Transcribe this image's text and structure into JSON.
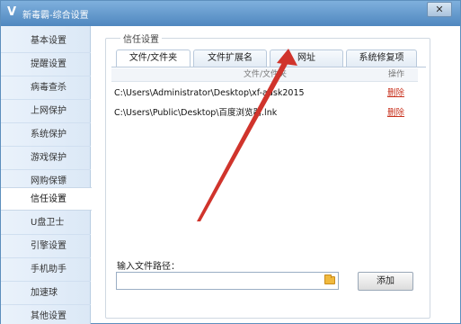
{
  "window": {
    "title": "新毒霸-综合设置",
    "logo": "V",
    "close": "✕"
  },
  "sidebar": {
    "items": [
      {
        "label": "基本设置"
      },
      {
        "label": "提醒设置"
      },
      {
        "label": "病毒查杀"
      },
      {
        "label": "上网保护"
      },
      {
        "label": "系统保护"
      },
      {
        "label": "游戏保护"
      },
      {
        "label": "网购保镖"
      },
      {
        "label": "信任设置",
        "active": true
      },
      {
        "label": "U盘卫士"
      },
      {
        "label": "引擎设置"
      },
      {
        "label": "手机助手"
      },
      {
        "label": "加速球"
      },
      {
        "label": "其他设置"
      }
    ]
  },
  "trust": {
    "group_title": "信任设置",
    "tabs": [
      {
        "label": "文件/文件夹",
        "active": true
      },
      {
        "label": "文件扩展名"
      },
      {
        "label": "网址"
      },
      {
        "label": "系统修复项"
      }
    ],
    "table": {
      "headers": {
        "path": "文件/文件夹",
        "action": "操作"
      },
      "rows": [
        {
          "path": "C:\\Users\\Administrator\\Desktop\\xf-adsk2015",
          "action": "删除"
        },
        {
          "path": "C:\\Users\\Public\\Desktop\\百度浏览器.lnk",
          "action": "删除"
        }
      ]
    },
    "input": {
      "label": "输入文件路径：",
      "value": "",
      "placeholder": ""
    },
    "add_button": "添加"
  },
  "icons": {
    "app": "kingsoft-logo-icon",
    "browse": "folder-icon",
    "annotation": "red-arrow"
  },
  "colors": {
    "titlebar": "#4f87bf",
    "delete_link": "#c8331f",
    "annotation_arrow": "#d0342c"
  }
}
